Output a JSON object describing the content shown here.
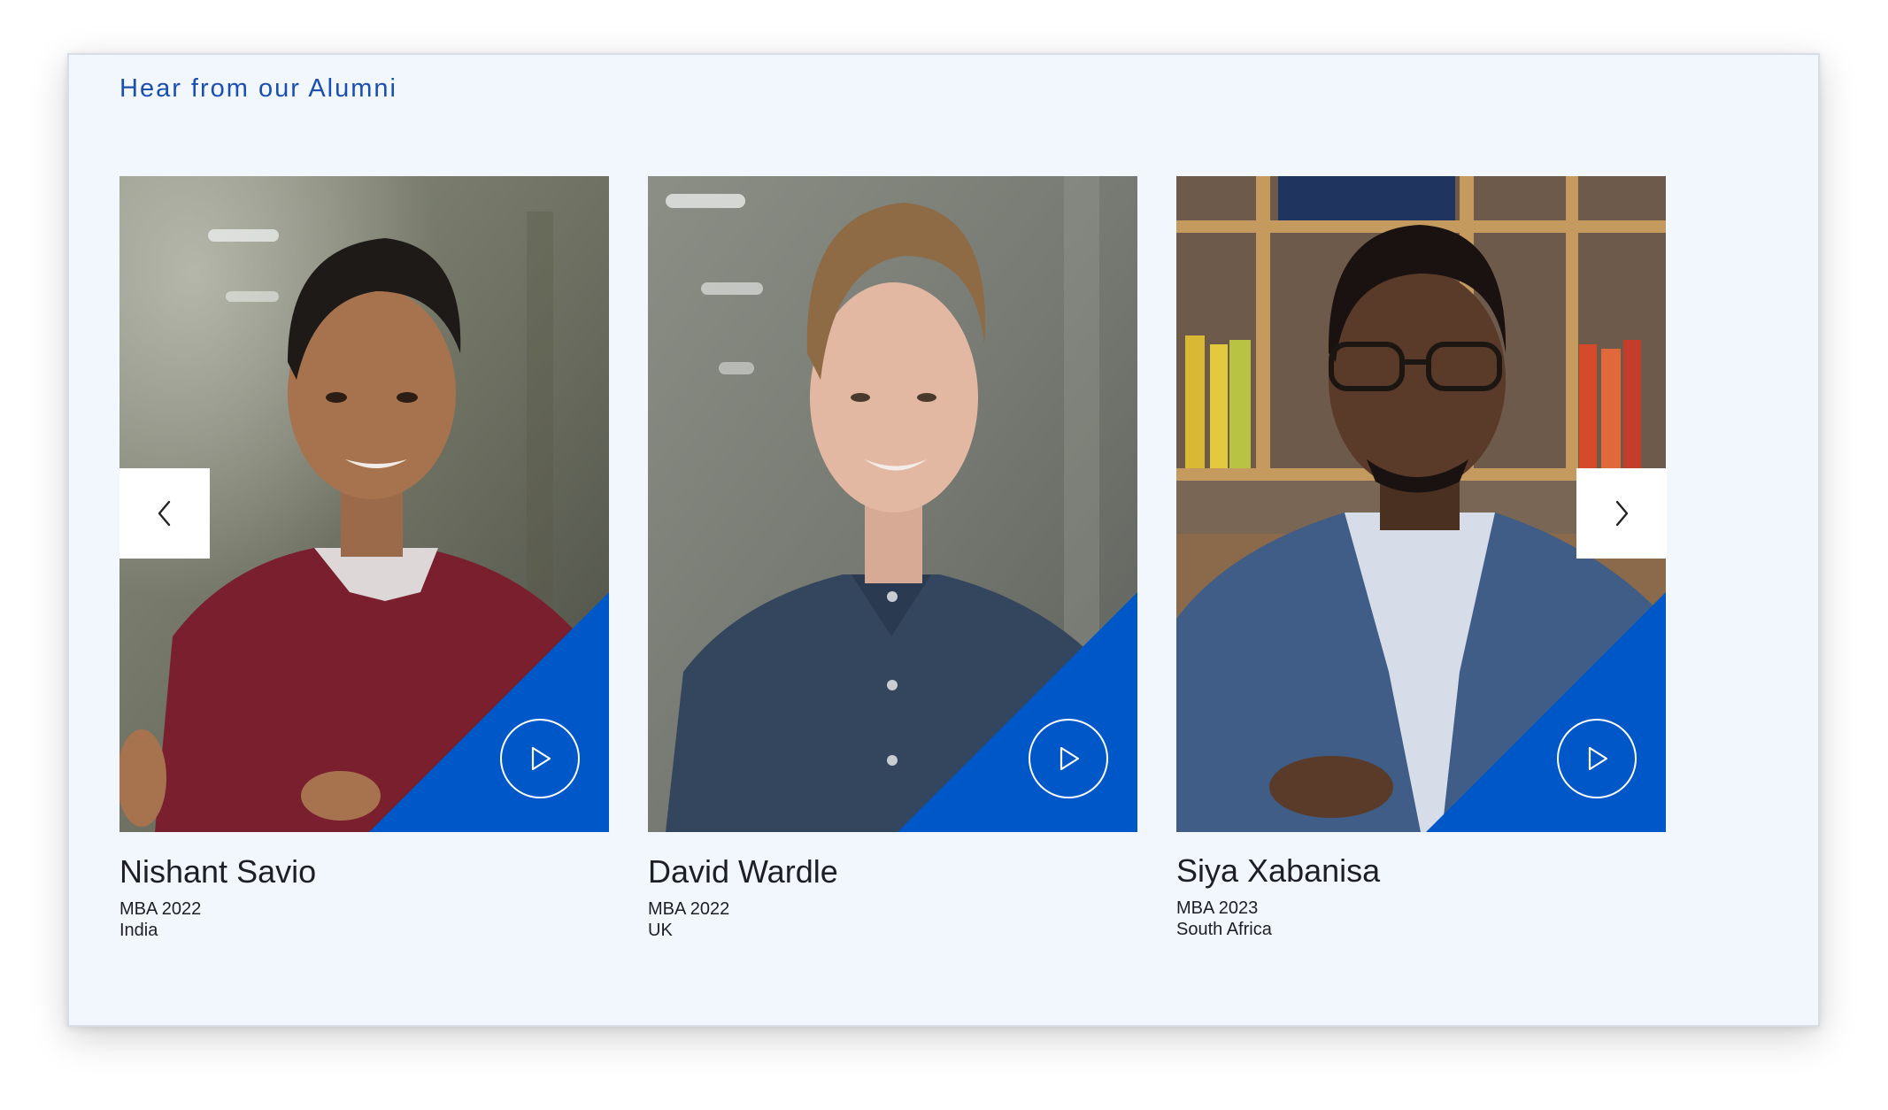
{
  "section": {
    "title": "Hear from our Alumni"
  },
  "colors": {
    "accent": "#0057c8",
    "title": "#1a4fb0",
    "background": "#f1f7fd"
  },
  "icons": {
    "prev": "chevron-left-icon",
    "next": "chevron-right-icon",
    "play": "play-icon"
  },
  "alumni": [
    {
      "name": "Nishant Savio",
      "program": "MBA 2022",
      "country": "India"
    },
    {
      "name": "David Wardle",
      "program": "MBA 2022",
      "country": "UK"
    },
    {
      "name": "Siya Xabanisa",
      "program": "MBA 2023",
      "country": "South Africa"
    }
  ]
}
